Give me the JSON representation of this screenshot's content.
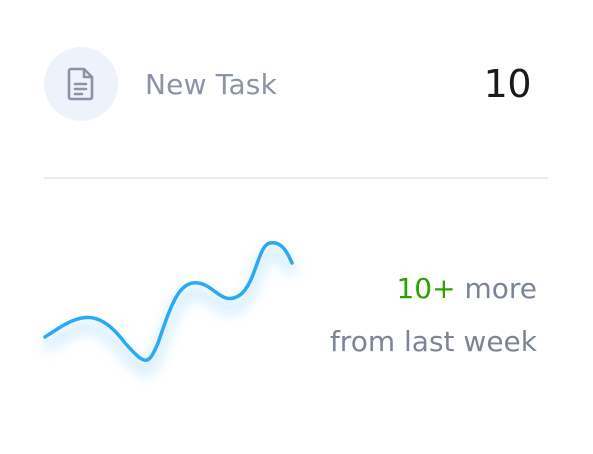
{
  "card": {
    "title": "New Task",
    "count": "10",
    "icon": "document-icon",
    "trend": {
      "delta": "10+",
      "delta_suffix": "more",
      "period": "from last week"
    },
    "colors": {
      "accent": "#2aa9f5",
      "delta": "#2aa200",
      "muted_text": "#8a94a6",
      "icon_bg": "#eef3fb"
    }
  }
}
